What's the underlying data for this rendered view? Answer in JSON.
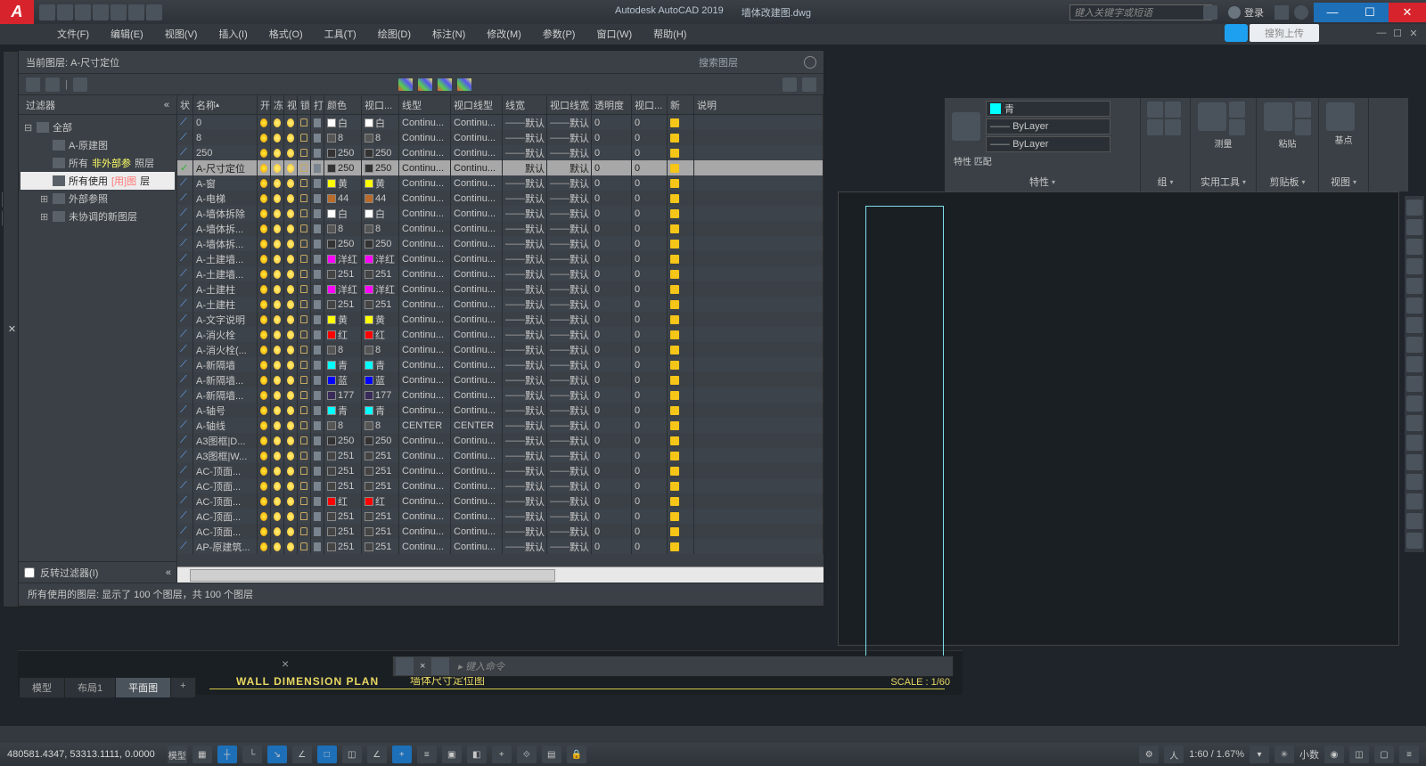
{
  "title": {
    "app": "Autodesk AutoCAD 2019",
    "doc": "墙体改建图.dwg"
  },
  "search_placeholder": "键入关键字或短语",
  "login": "登录",
  "sogou": "搜狗上传",
  "menus": [
    "文件(F)",
    "编辑(E)",
    "视图(V)",
    "插入(I)",
    "格式(O)",
    "工具(T)",
    "绘图(D)",
    "标注(N)",
    "修改(M)",
    "参数(P)",
    "窗口(W)",
    "帮助(H)"
  ],
  "palette": {
    "current_layer_label": "当前图层: A-尺寸定位",
    "search_layer": "搜索图层",
    "filter_label": "过滤器",
    "tree": {
      "all": "全部",
      "nodes": [
        "A-原建图",
        "所有非外部参照层",
        "所有使用的图层",
        "外部参照",
        "未协调的新图层"
      ],
      "active": "所有使用的图层"
    },
    "invert": "反转过滤器(I)",
    "headers": [
      "状",
      "名称",
      "开",
      "冻",
      "视",
      "锁",
      "打",
      "颜色",
      "视口...",
      "线型",
      "视口线型",
      "线宽",
      "视口线宽",
      "透明度",
      "视口...",
      "新",
      "说明"
    ],
    "status": "所有使用的图层: 显示了 100 个图层，共 100 个图层",
    "layers": [
      {
        "n": "0",
        "c": "白",
        "cc": "#fff",
        "lt": "Continu...",
        "cur": false
      },
      {
        "n": "8",
        "c": "8",
        "cc": "#555",
        "lt": "Continu...",
        "cur": false
      },
      {
        "n": "250",
        "c": "250",
        "cc": "#333",
        "lt": "Continu...",
        "cur": false
      },
      {
        "n": "A-尺寸定位",
        "c": "250",
        "cc": "#333",
        "lt": "Continu...",
        "cur": true,
        "sel": true
      },
      {
        "n": "A-窗",
        "c": "黄",
        "cc": "#ff0",
        "lt": "Continu...",
        "cur": false
      },
      {
        "n": "A-电梯",
        "c": "44",
        "cc": "#b86b2b",
        "lt": "Continu...",
        "cur": false
      },
      {
        "n": "A-墙体拆除",
        "c": "白",
        "cc": "#fff",
        "lt": "Continu...",
        "cur": false
      },
      {
        "n": "A-墙体拆...",
        "c": "8",
        "cc": "#555",
        "lt": "Continu...",
        "cur": false
      },
      {
        "n": "A-墙体拆...",
        "c": "250",
        "cc": "#333",
        "lt": "Continu...",
        "cur": false
      },
      {
        "n": "A-土建墙...",
        "c": "洋红",
        "cc": "#f0f",
        "lt": "Continu...",
        "cur": false
      },
      {
        "n": "A-土建墙...",
        "c": "251",
        "cc": "#444",
        "lt": "Continu...",
        "cur": false
      },
      {
        "n": "A-土建柱",
        "c": "洋红",
        "cc": "#f0f",
        "lt": "Continu...",
        "cur": false
      },
      {
        "n": "A-土建柱",
        "c": "251",
        "cc": "#444",
        "lt": "Continu...",
        "cur": false
      },
      {
        "n": "A-文字说明",
        "c": "黄",
        "cc": "#ff0",
        "lt": "Continu...",
        "cur": false
      },
      {
        "n": "A-消火栓",
        "c": "红",
        "cc": "#f00",
        "lt": "Continu...",
        "cur": false
      },
      {
        "n": "A-消火栓(...",
        "c": "8",
        "cc": "#555",
        "lt": "Continu...",
        "cur": false
      },
      {
        "n": "A-新隔墙",
        "c": "青",
        "cc": "#0ff",
        "lt": "Continu...",
        "cur": false
      },
      {
        "n": "A-新隔墙...",
        "c": "蓝",
        "cc": "#00f",
        "lt": "Continu...",
        "cur": false
      },
      {
        "n": "A-新隔墙...",
        "c": "177",
        "cc": "#3a2a5a",
        "lt": "Continu...",
        "cur": false
      },
      {
        "n": "A-轴号",
        "c": "青",
        "cc": "#0ff",
        "lt": "Continu...",
        "cur": false
      },
      {
        "n": "A-轴线",
        "c": "8",
        "cc": "#555",
        "lt": "CENTER",
        "cur": false
      },
      {
        "n": "A3图框|D...",
        "c": "250",
        "cc": "#333",
        "lt": "Continu...",
        "cur": false
      },
      {
        "n": "A3图框|W...",
        "c": "251",
        "cc": "#444",
        "lt": "Continu...",
        "cur": false
      },
      {
        "n": "AC-顶面...",
        "c": "251",
        "cc": "#444",
        "lt": "Continu...",
        "cur": false
      },
      {
        "n": "AC-顶面...",
        "c": "251",
        "cc": "#444",
        "lt": "Continu...",
        "cur": false
      },
      {
        "n": "AC-顶面...",
        "c": "红",
        "cc": "#f00",
        "lt": "Continu...",
        "cur": false
      },
      {
        "n": "AC-顶面...",
        "c": "251",
        "cc": "#444",
        "lt": "Continu...",
        "cur": false
      },
      {
        "n": "AC-顶面...",
        "c": "251",
        "cc": "#444",
        "lt": "Continu...",
        "cur": false
      },
      {
        "n": "AP-原建筑...",
        "c": "251",
        "cc": "#444",
        "lt": "Continu...",
        "cur": false
      }
    ],
    "row_defaults": {
      "lw": "默认",
      "tr": "0"
    }
  },
  "ribbon": {
    "color": "青",
    "color_hex": "#0ff",
    "bylayer": "ByLayer",
    "panels": [
      "特性",
      "组",
      "实用工具",
      "剪贴板",
      "视图"
    ],
    "props_label": "特性\n匹配",
    "group": "组",
    "measure": "测量",
    "paste": "粘贴",
    "base": "基点"
  },
  "drawing": {
    "title_en": "WALL DIMENSION PLAN",
    "title_cn": "墙体尺寸定位图",
    "scale": "SCALE : 1/60"
  },
  "cmd": {
    "prompt": "键入命令"
  },
  "layout_tabs": [
    "模型",
    "布局1",
    "平面图"
  ],
  "layout_active": "平面图",
  "status": {
    "coords": "480581.4347, 53313.1111, 0.0000",
    "space": "模型",
    "zoom": "1:60 / 1.67%",
    "decimal": "小数"
  }
}
